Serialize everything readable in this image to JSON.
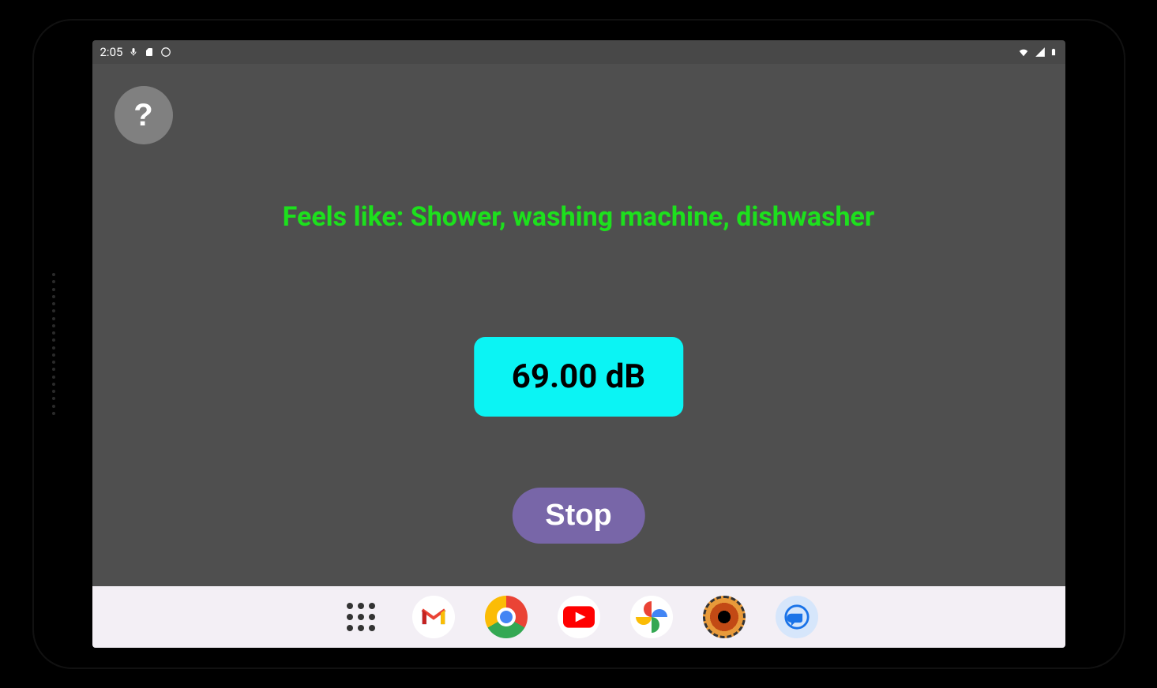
{
  "status_bar": {
    "time": "2:05",
    "left_icons": [
      "mic-icon",
      "sd-card-icon",
      "circle-icon"
    ],
    "right_icons": [
      "wifi-icon",
      "signal-icon",
      "battery-icon"
    ]
  },
  "app": {
    "help_label": "?",
    "feels_like_text": "Feels like: Shower, washing machine, dishwasher",
    "db_reading": "69.00 dB",
    "stop_label": "Stop"
  },
  "dock": {
    "items": [
      {
        "name": "app-drawer-icon"
      },
      {
        "name": "gmail-icon"
      },
      {
        "name": "chrome-icon"
      },
      {
        "name": "youtube-icon"
      },
      {
        "name": "photos-icon"
      },
      {
        "name": "app-unknown-icon"
      },
      {
        "name": "messages-icon"
      }
    ]
  }
}
